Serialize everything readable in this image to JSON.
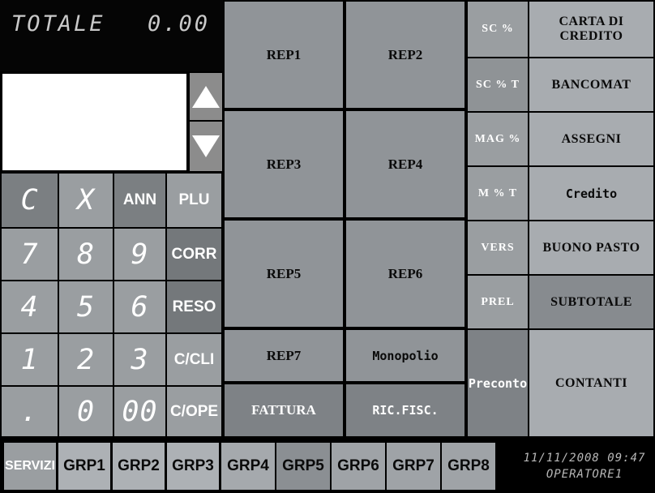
{
  "display": {
    "total_label": "TOTALE",
    "total_value": "0.00",
    "receipt_lines": [],
    "scroll_up_icon": "triangle-up-icon",
    "scroll_down_icon": "triangle-down-icon"
  },
  "keypad": {
    "keys": [
      {
        "label": "C",
        "style": "seg",
        "bg": "#7b7f82"
      },
      {
        "label": "X",
        "style": "seg",
        "bg": "#9a9ea1"
      },
      {
        "label": "ANN",
        "style": "txt",
        "bg": "#7b7f82"
      },
      {
        "label": "PLU",
        "style": "txt",
        "bg": "#9a9ea1"
      },
      {
        "label": "7",
        "style": "seg",
        "bg": "#9a9ea1"
      },
      {
        "label": "8",
        "style": "seg",
        "bg": "#9a9ea1"
      },
      {
        "label": "9",
        "style": "seg",
        "bg": "#9a9ea1"
      },
      {
        "label": "CORR",
        "style": "txt",
        "bg": "#74787b"
      },
      {
        "label": "4",
        "style": "seg",
        "bg": "#9a9ea1"
      },
      {
        "label": "5",
        "style": "seg",
        "bg": "#9a9ea1"
      },
      {
        "label": "6",
        "style": "seg",
        "bg": "#9a9ea1"
      },
      {
        "label": "RESO",
        "style": "txt",
        "bg": "#74787b"
      },
      {
        "label": "1",
        "style": "seg",
        "bg": "#9a9ea1"
      },
      {
        "label": "2",
        "style": "seg",
        "bg": "#9a9ea1"
      },
      {
        "label": "3",
        "style": "seg",
        "bg": "#9a9ea1"
      },
      {
        "label": "C/CLI",
        "style": "txt",
        "bg": "#9a9ea1"
      },
      {
        "label": ".",
        "style": "seg",
        "bg": "#9a9ea1"
      },
      {
        "label": "0",
        "style": "seg",
        "bg": "#9a9ea1"
      },
      {
        "label": "00",
        "style": "seg",
        "bg": "#9a9ea1"
      },
      {
        "label": "C/OPE",
        "style": "txt",
        "bg": "#9a9ea1"
      }
    ]
  },
  "departments": {
    "buttons": [
      {
        "label": "REP1",
        "style": "serif-dark",
        "bg": "#909498"
      },
      {
        "label": "REP2",
        "style": "serif-dark",
        "bg": "#909498"
      },
      {
        "label": "REP3",
        "style": "serif-dark",
        "bg": "#909498"
      },
      {
        "label": "REP4",
        "style": "serif-dark",
        "bg": "#909498"
      },
      {
        "label": "REP5",
        "style": "serif-dark",
        "bg": "#909498"
      },
      {
        "label": "REP6",
        "style": "serif-dark",
        "bg": "#909498"
      },
      {
        "label": "REP7",
        "style": "serif-dark",
        "bg": "#909498"
      },
      {
        "label": "Monopolio",
        "style": "mono-dark",
        "bg": "#909498"
      },
      {
        "label": "FATTURA",
        "style": "serif-light",
        "bg": "#7e8286"
      },
      {
        "label": "RIC.FISC.",
        "style": "mono-light",
        "bg": "#7e8286"
      }
    ]
  },
  "functions": {
    "buttons": [
      {
        "label": "SC %",
        "style": "serif-small-light",
        "bg": "#9a9ea1"
      },
      {
        "label": "SC % T",
        "style": "serif-small-light",
        "bg": "#8f9396"
      },
      {
        "label": "MAG %",
        "style": "serif-small-light",
        "bg": "#9a9ea1"
      },
      {
        "label": "M % T",
        "style": "serif-small-light",
        "bg": "#9a9ea1"
      },
      {
        "label": "VERS",
        "style": "serif-small-light",
        "bg": "#9a9ea1"
      },
      {
        "label": "PREL",
        "style": "serif-small-light",
        "bg": "#9a9ea1"
      },
      {
        "label": "Preconto",
        "style": "mono-light",
        "bg": "#7e8286"
      }
    ]
  },
  "payments": {
    "buttons": [
      {
        "label": "CARTA DI CREDITO",
        "style": "serif-mid-dark",
        "bg": "#a8acb0"
      },
      {
        "label": "BANCOMAT",
        "style": "serif-mid-dark",
        "bg": "#a8acb0"
      },
      {
        "label": "ASSEGNI",
        "style": "serif-mid-dark",
        "bg": "#a8acb0"
      },
      {
        "label": "Credito",
        "style": "mono-dark",
        "bg": "#a8acb0"
      },
      {
        "label": "BUONO PASTO",
        "style": "serif-mid-dark",
        "bg": "#a8acb0"
      },
      {
        "label": "SUBTOTALE",
        "style": "serif-mid-dark",
        "bg": "#878b8f"
      },
      {
        "label": "CONTANTI",
        "style": "serif-mid-dark",
        "bg": "#a8acb0"
      }
    ]
  },
  "groups": {
    "buttons": [
      {
        "label": "SERVIZI",
        "bg": "#9a9ea1",
        "text": "#ffffff"
      },
      {
        "label": "GRP1",
        "bg": "#adb1b5",
        "text": "#0a0a0a"
      },
      {
        "label": "GRP2",
        "bg": "#adb1b5",
        "text": "#0a0a0a"
      },
      {
        "label": "GRP3",
        "bg": "#adb1b5",
        "text": "#0a0a0a"
      },
      {
        "label": "GRP4",
        "bg": "#a5a9ad",
        "text": "#0a0a0a"
      },
      {
        "label": "GRP5",
        "bg": "#8b8f93",
        "text": "#0a0a0a"
      },
      {
        "label": "GRP6",
        "bg": "#9fa3a7",
        "text": "#0a0a0a"
      },
      {
        "label": "GRP7",
        "bg": "#9fa3a7",
        "text": "#0a0a0a"
      },
      {
        "label": "GRP8",
        "bg": "#9fa3a7",
        "text": "#0a0a0a"
      }
    ]
  },
  "status": {
    "datetime": "11/11/2008 09:47",
    "operator": "OPERATORE1"
  }
}
